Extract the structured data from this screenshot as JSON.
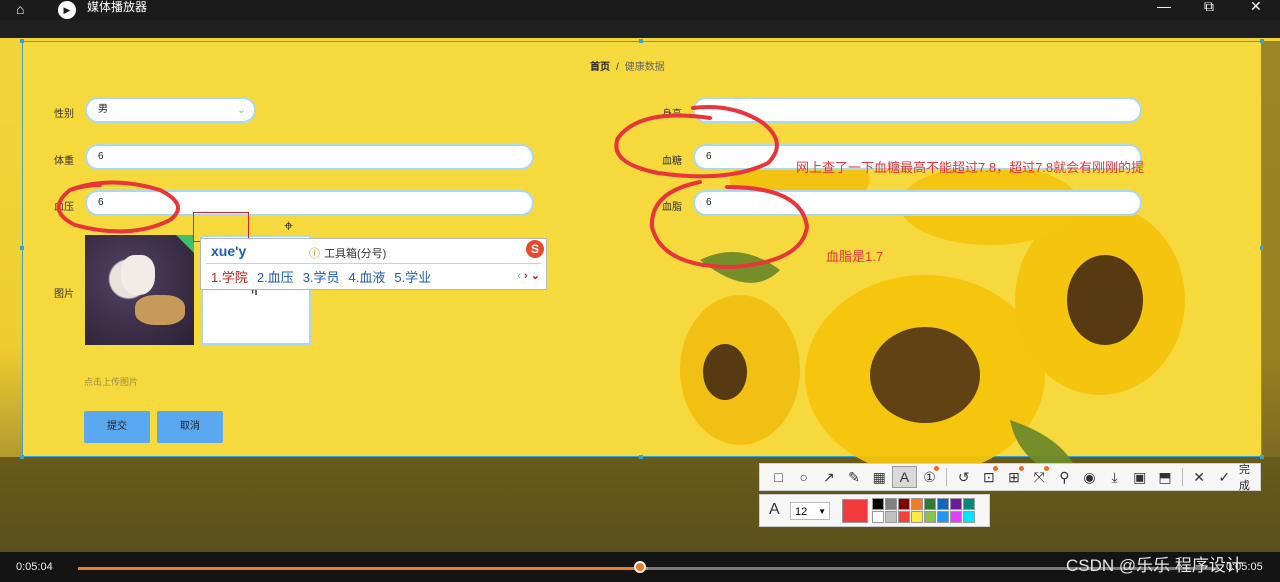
{
  "window": {
    "title": "媒体播放器"
  },
  "breadcrumb": {
    "home": "首页",
    "separator": "/",
    "current": "健康数据"
  },
  "form": {
    "gender_label": "性别",
    "gender_value": "男",
    "height_label": "身高",
    "height_value": "",
    "weight_label": "体重",
    "weight_value": "6",
    "blood_sugar_label": "血糖",
    "blood_sugar_value": "6",
    "blood_pressure_label": "血压",
    "blood_pressure_value": "6",
    "blood_fat_label": "血脂",
    "blood_fat_value": "6",
    "image_label": "图片",
    "upload_hint": "点击上传图片",
    "submit_label": "提交",
    "cancel_label": "取消"
  },
  "ime": {
    "pinyin": "xue'y",
    "toolbox_hint": "工具箱(分号)",
    "candidates": [
      "1.学院",
      "2.血压",
      "3.学员",
      "4.血液",
      "5.学业"
    ]
  },
  "annotations": {
    "note_blood_sugar": "网上查了一下血糖最高不能超过7.8，超过7.8就会有刚刚的提",
    "note_blood_fat": "血脂是1.7"
  },
  "screenshot_tool": {
    "font_size": "12",
    "done_label": "完成",
    "current_color": "#f03c3c",
    "palette": [
      "#000000",
      "#808080",
      "#800000",
      "#f07b2a",
      "#2e7d32",
      "#1565c0",
      "#6a1b9a",
      "#00897b",
      "#ffffff",
      "#c0c0c0",
      "#f44336",
      "#ffeb3b",
      "#8bc34a",
      "#2196f3",
      "#e040fb",
      "#00e5ff"
    ]
  },
  "player": {
    "elapsed": "0:05:04",
    "remaining": "0:05:05",
    "progress": 0.5
  },
  "watermark": "CSDN @乐乐 程序设计"
}
